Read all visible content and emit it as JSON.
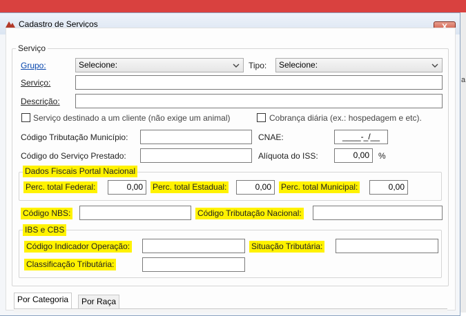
{
  "window": {
    "title": "Cadastro de Serviços",
    "close_label": "X"
  },
  "servico_group": {
    "legend": "Serviço",
    "grupo_label": "Grupo:",
    "grupo_value": "Selecione:",
    "tipo_label": "Tipo:",
    "tipo_value": "Selecione:",
    "servico_label": "Serviço:",
    "servico_value": "",
    "descricao_label": "Descrição:",
    "descricao_value": "",
    "cliente_check_label": "Serviço destinado a um cliente (não exige um animal)",
    "cliente_checked": false,
    "diaria_check_label": "Cobrança diária (ex.: hospedagem e etc).",
    "diaria_checked": false,
    "cod_trib_municipio_label": "Código Tributação Município:",
    "cod_trib_municipio_value": "",
    "cnae_label": "CNAE:",
    "cnae_value": "____-_/__",
    "cod_servico_prestado_label": "Código do Serviço Prestado:",
    "cod_servico_prestado_value": "",
    "aliquota_iss_label": "Alíquota do ISS:",
    "aliquota_iss_value": "0,00",
    "aliquota_unit": "%"
  },
  "fiscal_group": {
    "legend": "Dados Fiscais Portal Nacional",
    "perc_federal_label": "Perc. total Federal:",
    "perc_federal_value": "0,00",
    "perc_estadual_label": "Perc. total Estadual:",
    "perc_estadual_value": "0,00",
    "perc_municipal_label": "Perc. total Municipal:",
    "perc_municipal_value": "0,00"
  },
  "nbs": {
    "codigo_nbs_label": "Código NBS:",
    "codigo_nbs_value": "",
    "cod_trib_nacional_label": "Código Tributação Nacional:",
    "cod_trib_nacional_value": ""
  },
  "ibs_group": {
    "legend": "IBS e CBS",
    "cod_indicador_label": "Código Indicador Operação:",
    "cod_indicador_value": "",
    "situacao_label": "Situação Tributária:",
    "situacao_value": "",
    "classificacao_label": "Classificação Tributária:",
    "classificacao_value": ""
  },
  "tabs": [
    {
      "label": "Por Categoria",
      "active": true
    },
    {
      "label": "Por Raça",
      "active": false
    }
  ],
  "background": {
    "edge_text": "a"
  },
  "colors": {
    "highlight": "#fff200",
    "link": "#0645ad",
    "window_border": "#8aa2c0",
    "top_bar": "#d9413f"
  }
}
